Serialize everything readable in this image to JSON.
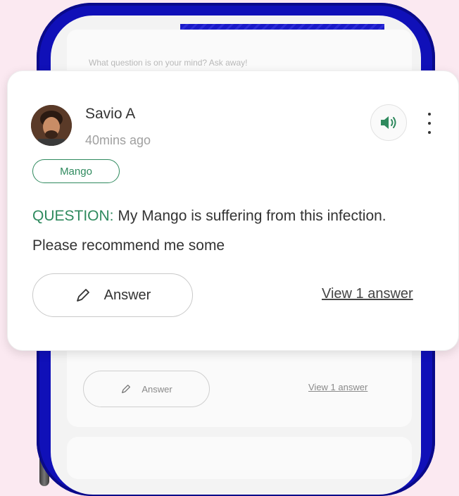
{
  "background": {
    "search_placeholder": "What question is on your mind? Ask away!",
    "card": {
      "answer_label": "Answer",
      "view_label": "View 1 answer"
    }
  },
  "post": {
    "user_name": "Savio A",
    "time_ago": "40mins ago",
    "tag": "Mango",
    "question_label": "QUESTION:",
    "question_text": "My Mango is suffering from this infection. Please recommend me some",
    "answer_label": "Answer",
    "view_answers_label": "View 1 answer"
  },
  "colors": {
    "accent": "#2f8a5e",
    "frame": "#1010b8",
    "background": "#fbe9f1"
  },
  "icons": [
    "speaker-icon",
    "more-vertical-icon",
    "pencil-icon"
  ]
}
